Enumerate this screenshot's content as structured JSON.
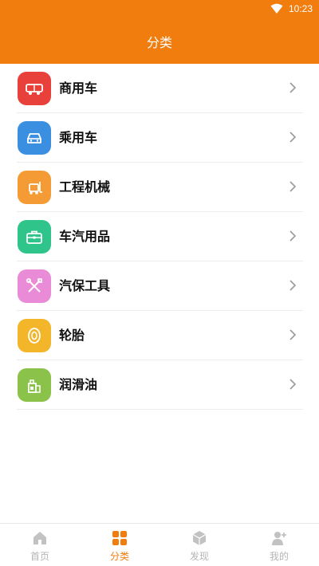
{
  "status_bar": {
    "time": "10:23",
    "wifi_icon": "wifi-icon"
  },
  "header": {
    "title": "分类",
    "color": "#f07d0e"
  },
  "categories": [
    {
      "label": "商用车",
      "icon": "truck-icon",
      "color": "#e8403a"
    },
    {
      "label": "乘用车",
      "icon": "car-icon",
      "color": "#3a8fe0"
    },
    {
      "label": "工程机械",
      "icon": "forklift-icon",
      "color": "#f49b35"
    },
    {
      "label": "车汽用品",
      "icon": "toolbox-icon",
      "color": "#2fc58a"
    },
    {
      "label": "汽保工具",
      "icon": "tools-icon",
      "color": "#e98bd6"
    },
    {
      "label": "轮胎",
      "icon": "tire-icon",
      "color": "#f3b62a"
    },
    {
      "label": "润滑油",
      "icon": "oil-bottle-icon",
      "color": "#8bc34a"
    }
  ],
  "tabs": [
    {
      "label": "首页",
      "icon": "home-icon",
      "active": false
    },
    {
      "label": "分类",
      "icon": "grid-icon",
      "active": true
    },
    {
      "label": "发现",
      "icon": "cube-icon",
      "active": false
    },
    {
      "label": "我的",
      "icon": "user-add-icon",
      "active": false
    }
  ]
}
